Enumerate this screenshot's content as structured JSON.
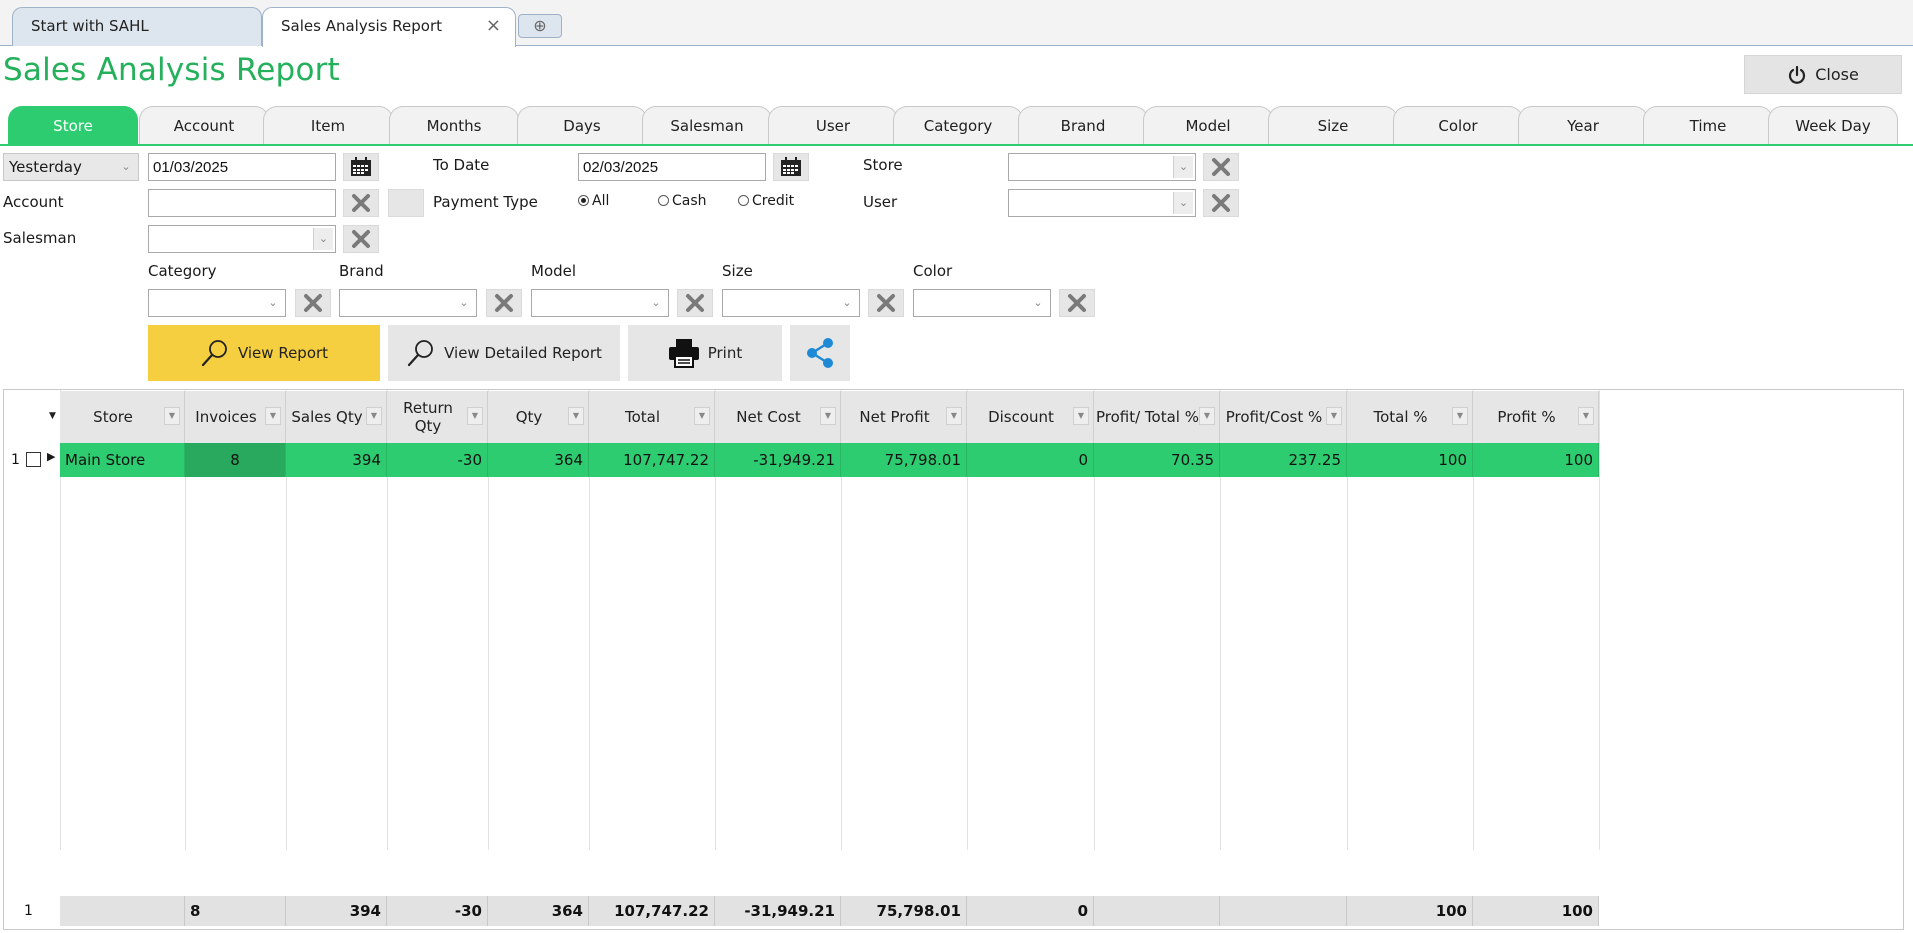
{
  "doc_tabs": [
    {
      "label": "Start with SAHL"
    },
    {
      "label": "Sales Analysis Report"
    }
  ],
  "page_title": "Sales Analysis Report",
  "close_label": "Close",
  "group_tabs": [
    "Store",
    "Account",
    "Item",
    "Months",
    "Days",
    "Salesman",
    "User",
    "Category",
    "Brand",
    "Model",
    "Size",
    "Color",
    "Year",
    "Time",
    "Week Day"
  ],
  "filters": {
    "period": "Yesterday",
    "from_date": "01/03/2025",
    "to_date_label": "To Date",
    "to_date": "02/03/2025",
    "store_label": "Store",
    "account_label": "Account",
    "payment_type_label": "Payment Type",
    "payment_all": "All",
    "payment_cash": "Cash",
    "payment_credit": "Credit",
    "user_label": "User",
    "salesman_label": "Salesman",
    "category_label": "Category",
    "brand_label": "Brand",
    "model_label": "Model",
    "size_label": "Size",
    "color_label": "Color"
  },
  "actions": {
    "view_report": "View Report",
    "view_detailed_report": "View Detailed Report",
    "print": "Print"
  },
  "grid": {
    "columns": [
      "Store",
      "Invoices",
      "Sales Qty",
      "Return Qty",
      "Qty",
      "Total",
      "Net Cost",
      "Net Profit",
      "Discount",
      "Profit/ Total %",
      "Profit/Cost %",
      "Total %",
      "Profit %"
    ],
    "rows": [
      {
        "num": "1",
        "cells": [
          "Main Store",
          "8",
          "394",
          "-30",
          "364",
          "107,747.22",
          "-31,949.21",
          "75,798.01",
          "0",
          "70.35",
          "237.25",
          "100",
          "100"
        ]
      }
    ],
    "footer_num": "1",
    "footer": [
      "",
      "8",
      "394",
      "-30",
      "364",
      "107,747.22",
      "-31,949.21",
      "75,798.01",
      "0",
      "",
      "",
      "100",
      "100"
    ]
  },
  "colors": {
    "accent_green": "#2ecc71",
    "title_green": "#25b05c",
    "view_button_yellow": "#f5cf3f",
    "share_blue": "#1e8ad6"
  }
}
